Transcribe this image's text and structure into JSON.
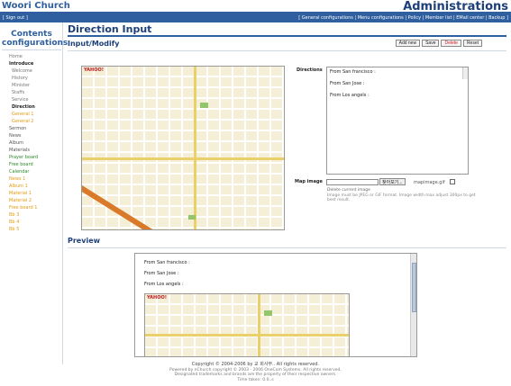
{
  "header": {
    "brand": "Woori Church",
    "admin_title": "Administrations",
    "signout": "[ Sign out ]",
    "top_links": "[ General configurations | Menu configurations | Policy | Member list | EMail center | Backup ]"
  },
  "sidebar": {
    "title_line1": "Contents",
    "title_line2": "configurations",
    "items": [
      {
        "label": "Home",
        "style": "gray"
      },
      {
        "label": "Introduce",
        "style": "bold"
      },
      {
        "label": "Welcome",
        "style": "gray"
      },
      {
        "label": "History",
        "style": "gray"
      },
      {
        "label": "Minister",
        "style": "gray"
      },
      {
        "label": "Staffs",
        "style": "gray"
      },
      {
        "label": "Service",
        "style": "gray"
      },
      {
        "label": "Direction",
        "style": "bold"
      },
      {
        "label": "General 1",
        "style": "orange"
      },
      {
        "label": "General 2",
        "style": "orange"
      },
      {
        "label": "Sermon",
        "style": "darkgray"
      },
      {
        "label": "News",
        "style": "darkgray"
      },
      {
        "label": "Album",
        "style": "darkgray"
      },
      {
        "label": "Materials",
        "style": "darkgray"
      },
      {
        "label": "Prayer board",
        "style": "green"
      },
      {
        "label": "Free board",
        "style": "green"
      },
      {
        "label": "Calendar",
        "style": "green"
      },
      {
        "label": "News 1",
        "style": "orange"
      },
      {
        "label": "Album 1",
        "style": "orange"
      },
      {
        "label": "Material 1",
        "style": "orange"
      },
      {
        "label": "Material 2",
        "style": "orange"
      },
      {
        "label": "Free board 1",
        "style": "orange"
      },
      {
        "label": "Bb 3",
        "style": "orange"
      },
      {
        "label": "Bb 4",
        "style": "orange"
      },
      {
        "label": "Bb 5",
        "style": "orange"
      }
    ]
  },
  "main": {
    "page_title": "Direction Input",
    "section_title": "Input/Modify",
    "buttons": {
      "add_new": "Add new",
      "save": "Save",
      "delete": "Delete",
      "reset": "Reset"
    },
    "directions_label": "Directions",
    "directions_lines": [
      "From San francisco :",
      "From San Jose :",
      "From Los angels :"
    ],
    "map_image_label": "Map image",
    "browse_label": "찾아보기...",
    "map_image_file": "mapimage.gif",
    "delete_current": "Delete current image",
    "image_note": "Image must be JPEG or GIF format. Image width max adjust 300px to get best result.",
    "preview_title": "Preview",
    "map_brand": "YAHOO!"
  },
  "footer": {
    "copyright": "Copyright © 2004-2006 by 교 회사무.. All rights reserved.",
    "powered": "Powered by nChurch copyright © 2003 - 2006 OneCom Systems. All rights reserved.",
    "trademark": "Designated trademarks and brands are the property of their respective owners.",
    "timing": "Time taken: 0.0..s"
  },
  "colors": {
    "accent": "#2f5f9f",
    "title": "#1d3f7a",
    "delete": "#d02020",
    "orange_menu": "#e39b17",
    "green_menu": "#2c8a2c"
  }
}
